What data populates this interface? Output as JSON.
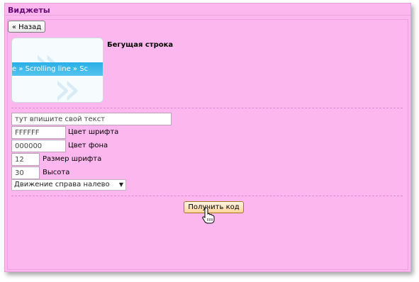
{
  "panel": {
    "title": "Виджеты"
  },
  "back_button": {
    "label": "« Назад"
  },
  "widget": {
    "name": "Бегущая строка",
    "preview_text": "e » Scrolling line » Sc"
  },
  "form": {
    "text_input": {
      "value": "тут впишите свой текст"
    },
    "font_color": {
      "value": "FFFFFF",
      "label": "Цвет шрифта"
    },
    "bg_color": {
      "value": "000000",
      "label": "Цвет фона"
    },
    "font_size": {
      "value": "12",
      "label": "Размер шрифта"
    },
    "height": {
      "value": "30",
      "label": "Высота"
    },
    "direction": {
      "selected": "Движение справа налево"
    }
  },
  "get_code_button": {
    "label": "Получить код"
  },
  "colors": {
    "panel_bg": "#fcb8ee",
    "title": "#6a0a73",
    "band": "#29aee6",
    "button": "#ffd59a"
  }
}
